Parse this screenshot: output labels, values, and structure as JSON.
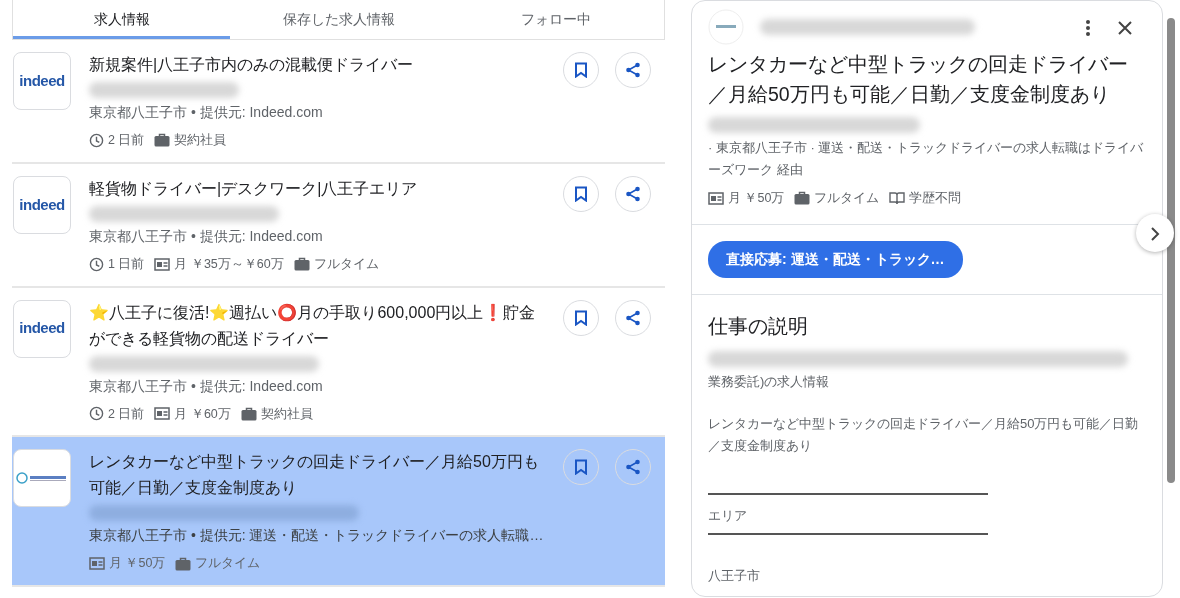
{
  "tabs": [
    {
      "label": "求人情報",
      "selected": true
    },
    {
      "label": "保存した求人情報",
      "selected": false
    },
    {
      "label": "フォロー中",
      "selected": false
    }
  ],
  "jobs": [
    {
      "logo": {
        "kind": "wordmark",
        "text": "indeed"
      },
      "title": "新規案件|八王子市内のみの混載便ドライバー",
      "source": "東京都八王子市 • 提供元: Indeed.com",
      "meta": [
        {
          "kind": "time",
          "text": "2 日前"
        },
        {
          "kind": "type",
          "text": "契約社員"
        }
      ],
      "selected": false
    },
    {
      "logo": {
        "kind": "wordmark",
        "text": "indeed"
      },
      "title": "軽貨物ドライバー|デスクワーク|八王子エリア",
      "source": "東京都八王子市 • 提供元: Indeed.com",
      "meta": [
        {
          "kind": "time",
          "text": "1 日前"
        },
        {
          "kind": "salary",
          "text": "月 ￥35万～￥60万"
        },
        {
          "kind": "type",
          "text": "フルタイム"
        }
      ],
      "selected": false
    },
    {
      "logo": {
        "kind": "wordmark",
        "text": "indeed"
      },
      "title": "⭐八王子に復活!⭐週払い⭕月の手取り600,000円以上❗貯金ができる軽貨物の配送ドライバー",
      "source": "東京都八王子市 • 提供元: Indeed.com",
      "meta": [
        {
          "kind": "time",
          "text": "2 日前"
        },
        {
          "kind": "salary",
          "text": "月 ￥60万"
        },
        {
          "kind": "type",
          "text": "契約社員"
        }
      ],
      "selected": false
    },
    {
      "logo": {
        "kind": "emblem"
      },
      "title": "レンタカーなど中型トラックの回走ドライバー／月給50万円も可能／日勤／支度金制度あり",
      "source": "東京都八王子市 • 提供元: 運送・配送・トラックドライバーの求人転職…",
      "meta": [
        {
          "kind": "salary",
          "text": "月 ￥50万"
        },
        {
          "kind": "type",
          "text": "フルタイム"
        }
      ],
      "selected": true
    }
  ],
  "detail": {
    "title": "レンタカーなど中型トラックの回走ドライバー／月給50万円も可能／日勤／支度金制度あり",
    "source": "· 東京都八王子市 · 運送・配送・トラックドライバーの求人転職はドライバーズワーク 経由",
    "meta": [
      {
        "kind": "salary",
        "text": "月 ￥50万"
      },
      {
        "kind": "type",
        "text": "フルタイム"
      },
      {
        "kind": "education",
        "text": "学歴不問"
      }
    ],
    "apply_button": "直接応募: 運送・配送・トラック…",
    "section_title": "仕事の説明",
    "paragraphs": [
      "業務委託)の求人情報",
      "レンタカーなど中型トラックの回走ドライバー／月給50万円も可能／日勤／支度金制度あり"
    ],
    "fields": [
      "エリア",
      "八王子市"
    ]
  }
}
